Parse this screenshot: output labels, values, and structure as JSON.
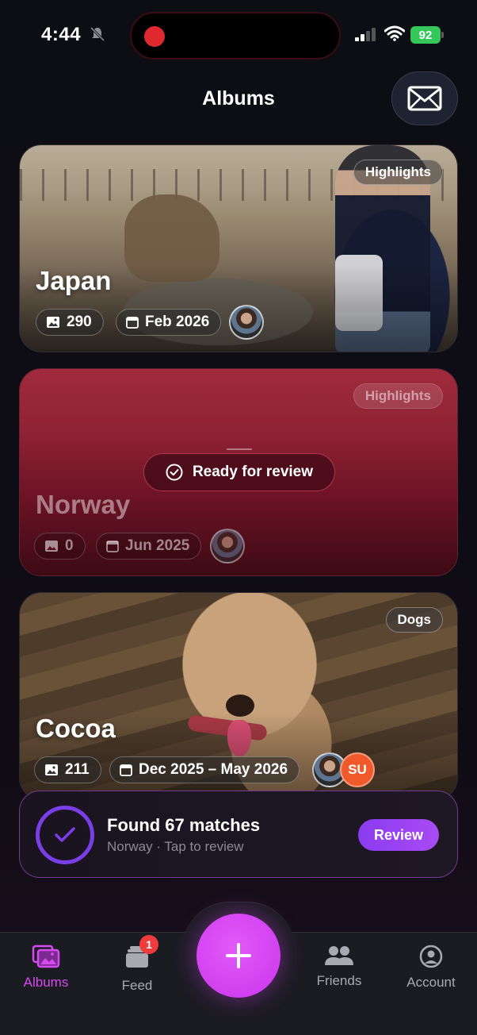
{
  "status": {
    "time": "4:44",
    "battery": "92"
  },
  "header": {
    "title": "Albums"
  },
  "albums": [
    {
      "title": "Japan",
      "tag": "Highlights",
      "count": "290",
      "date": "Feb 2026"
    },
    {
      "title": "Norway",
      "tag": "Highlights",
      "count": "0",
      "date": "Jun 2025",
      "review_label": "Ready for review"
    },
    {
      "title": "Cocoa",
      "tag": "Dogs",
      "count": "211",
      "date": "Dec 2025 – May 2026",
      "extra_avatar": "SU"
    }
  ],
  "match_banner": {
    "title": "Found 67 matches",
    "subtitle": "Norway · Tap to review",
    "button": "Review"
  },
  "tabs": [
    {
      "label": "Albums"
    },
    {
      "label": "Feed",
      "badge": "1"
    },
    {
      "label": "Friends"
    },
    {
      "label": "Account"
    }
  ],
  "colors": {
    "accent": "#d64af0",
    "review_purple": "#8a3cf0",
    "battery_green": "#34c759"
  }
}
